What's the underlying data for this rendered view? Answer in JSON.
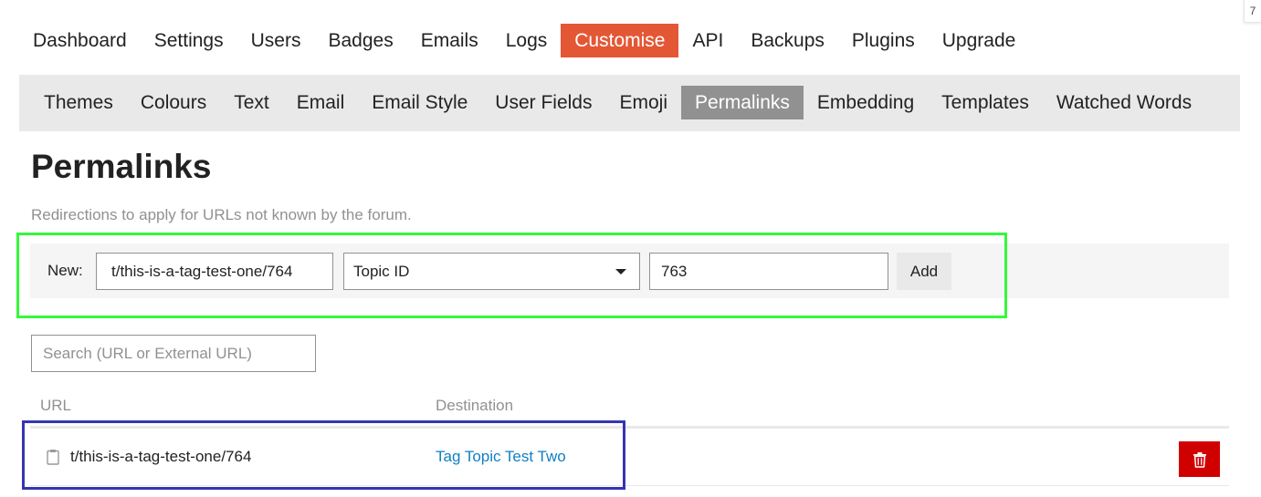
{
  "corner_badge": "7",
  "main_nav": [
    {
      "label": "Dashboard"
    },
    {
      "label": "Settings"
    },
    {
      "label": "Users"
    },
    {
      "label": "Badges"
    },
    {
      "label": "Emails"
    },
    {
      "label": "Logs"
    },
    {
      "label": "Customise",
      "active": true
    },
    {
      "label": "API"
    },
    {
      "label": "Backups"
    },
    {
      "label": "Plugins"
    },
    {
      "label": "Upgrade"
    }
  ],
  "sub_nav": [
    {
      "label": "Themes"
    },
    {
      "label": "Colours"
    },
    {
      "label": "Text"
    },
    {
      "label": "Email"
    },
    {
      "label": "Email Style"
    },
    {
      "label": "User Fields"
    },
    {
      "label": "Emoji"
    },
    {
      "label": "Permalinks",
      "active": true
    },
    {
      "label": "Embedding"
    },
    {
      "label": "Templates"
    },
    {
      "label": "Watched Words"
    }
  ],
  "page": {
    "title": "Permalinks",
    "description": "Redirections to apply for URLs not known by the forum."
  },
  "new_form": {
    "label": "New:",
    "url_value": "t/this-is-a-tag-test-one/764",
    "type_selected": "Topic ID",
    "value": "763",
    "add_label": "Add"
  },
  "search": {
    "placeholder": "Search (URL or External URL)",
    "value": ""
  },
  "table": {
    "headers": {
      "url": "URL",
      "destination": "Destination"
    },
    "rows": [
      {
        "url": "t/this-is-a-tag-test-one/764",
        "destination": "Tag Topic Test Two"
      }
    ]
  },
  "colors": {
    "accent_active_main": "#e45735",
    "accent_active_sub": "#919191",
    "link": "#0f7fc5",
    "danger": "#d10000",
    "highlight_green": "#35f83b",
    "highlight_blue": "#3535b2"
  },
  "icons": {
    "row_copy": "clipboard-icon",
    "row_delete": "trash-icon",
    "select_caret": "caret-down-icon"
  }
}
